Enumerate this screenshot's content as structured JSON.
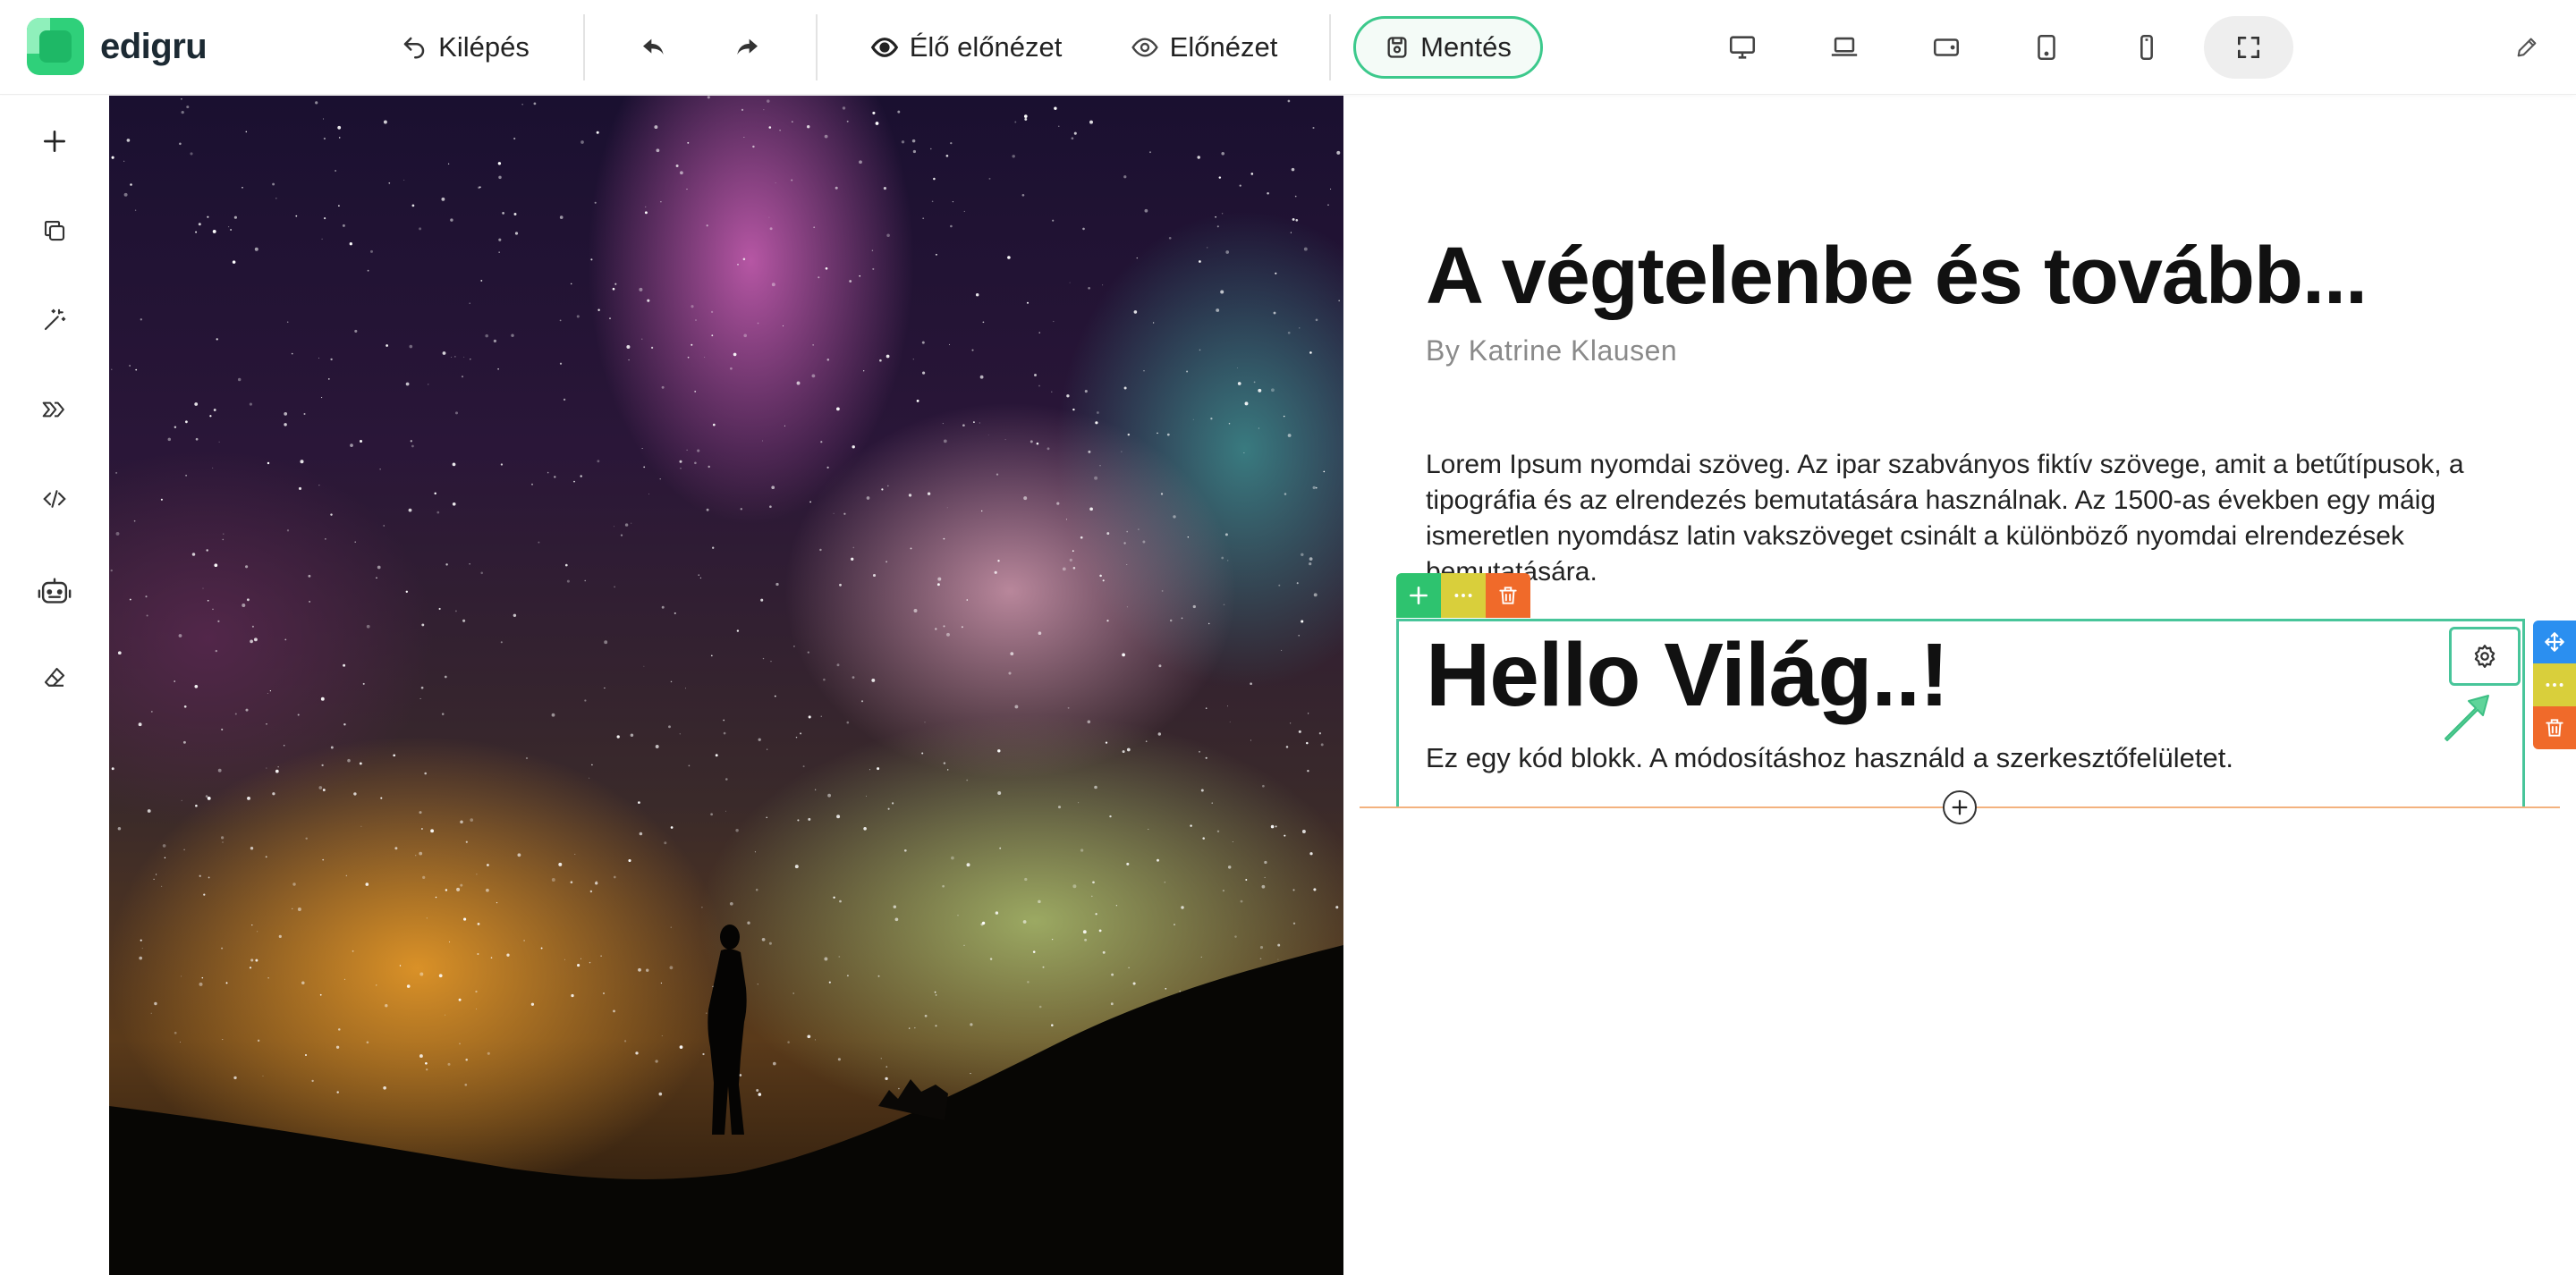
{
  "app": {
    "logo_text": "edigru"
  },
  "toolbar": {
    "exit_label": "Kilépés",
    "live_preview_label": "Élő előnézet",
    "preview_label": "Előnézet",
    "save_label": "Mentés",
    "devices": [
      "desktop-icon",
      "laptop-icon",
      "tablet-landscape-icon",
      "tablet-portrait-icon",
      "mobile-icon",
      "fullscreen-icon"
    ],
    "edit_icon": "pencil-icon"
  },
  "sidebar": {
    "items": [
      "plus-icon",
      "copy-icon",
      "magic-wand-icon",
      "transitions-icon",
      "code-icon",
      "robot-icon",
      "eraser-icon"
    ]
  },
  "content": {
    "title": "A végtelenbe és tovább...",
    "author": "By Katrine Klausen",
    "paragraph": "Lorem Ipsum nyomdai szöveg. Az ipar szabványos fiktív szövege, amit a betűtípusok, a tipográfia és az elrendezés bemutatására használnak. Az 1500-as években egy máig ismeretlen nyomdász latin vakszöveget csinált a különböző nyomdai elrendezések bemutatására.",
    "code_block": {
      "heading": "Hello Világ..!",
      "description": "Ez egy kód blokk. A módosításhoz használd a szerkesztőfelületet."
    }
  },
  "colors": {
    "accent": "#2ec36f",
    "save_border": "#3cc98c",
    "block_outline": "#48c59a",
    "tool_yellow": "#d9cf3b",
    "tool_red": "#f06a2a",
    "tool_blue": "#2b8ff0",
    "insert_line": "#f3b27e"
  }
}
